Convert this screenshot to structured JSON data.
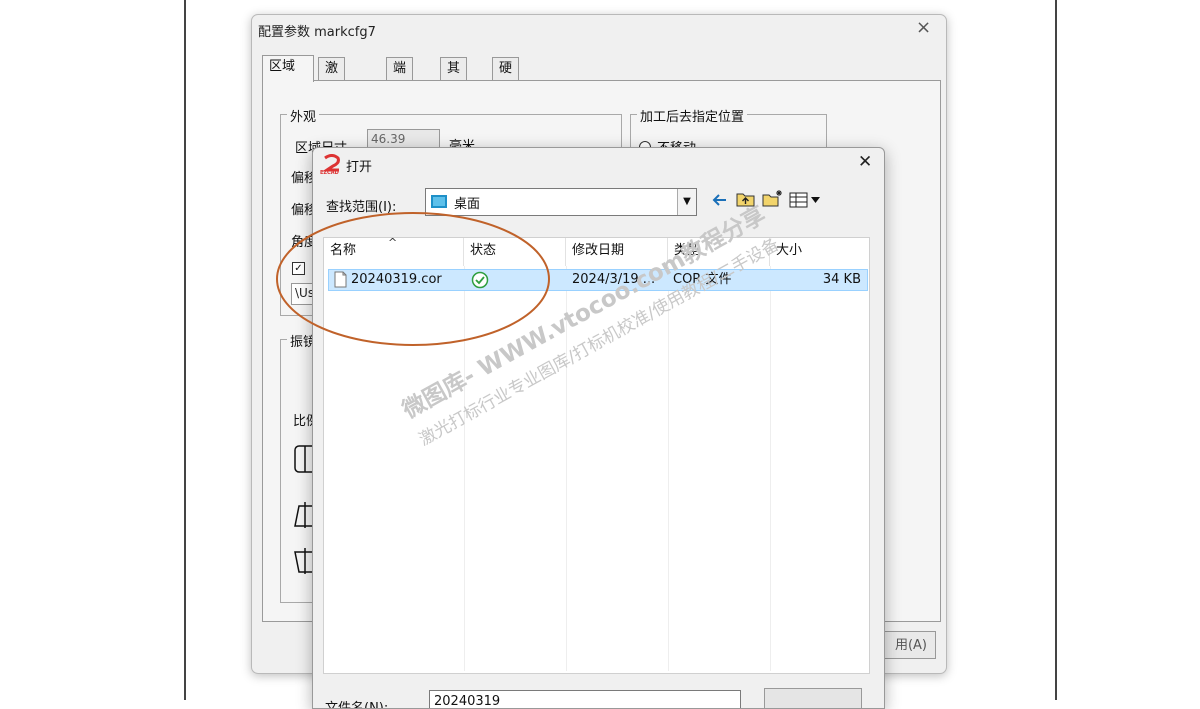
{
  "config_dialog": {
    "title": "配置参数 markcfg7",
    "close_glyph": "×",
    "tabs": [
      {
        "label": "区域"
      },
      {
        "label": "激光控制"
      },
      {
        "label": "端口"
      },
      {
        "label": "其它"
      },
      {
        "label": "硬件信息"
      }
    ],
    "appearance": {
      "label": "外观",
      "area_size_label": "区域尺寸",
      "area_size_value": "46.39",
      "unit": "毫米",
      "offset_label_1": "偏移",
      "offset_label_2": "偏移",
      "angle_label": "角度",
      "checkbox_checked": true,
      "path_value": "\\Us"
    },
    "galvo": {
      "label": "振镜",
      "ratio_label": "比例"
    },
    "after_process": {
      "label": "加工后去指定位置",
      "option_label": "不移动"
    },
    "apply_button": "用(A)"
  },
  "open_dialog": {
    "logo_text": "EZCAD",
    "title": "打开",
    "close_glyph": "✕",
    "lookin_label": "查找范围(I):",
    "lookin_value": "桌面",
    "sort_indicator": "^",
    "columns": [
      "名称",
      "状态",
      "修改日期",
      "类型",
      "大小"
    ],
    "files": [
      {
        "name": "20240319.cor",
        "status": "synced",
        "modified": "2024/3/19 ...",
        "type": "COR 文件",
        "size": "34 KB"
      }
    ],
    "filename_label": "文件名(N):",
    "filename_value": "20240319"
  },
  "watermark": {
    "line1": "微图库- WWW.vtocoo.com教程分享",
    "line2": "激光打标行业专业图库/打标机校准/使用教程/二手设备"
  },
  "colors": {
    "selection": "#cce8ff",
    "annotation_circle": "#c0622a",
    "status_ok": "#2e9e3e",
    "desktop_icon": "#1e90c8"
  }
}
